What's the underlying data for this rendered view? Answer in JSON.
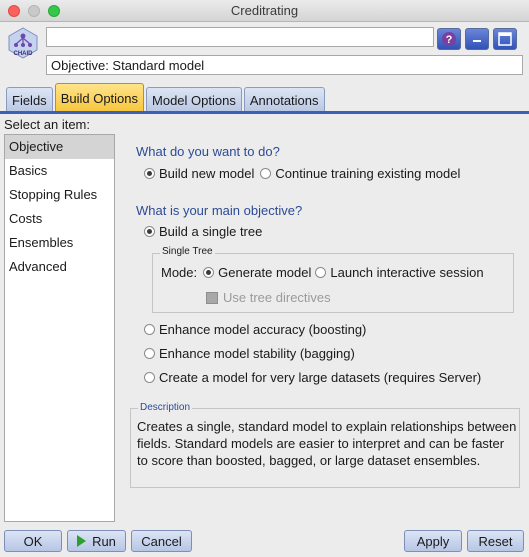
{
  "window": {
    "title": "Creditrating"
  },
  "header": {
    "node_name_value": "",
    "objective_line": "Objective: Standard model",
    "icon_name": "chaid-node-icon",
    "icon_label": "CHAID"
  },
  "tabs": [
    {
      "label": "Fields",
      "active": false
    },
    {
      "label": "Build Options",
      "active": true
    },
    {
      "label": "Model Options",
      "active": false
    },
    {
      "label": "Annotations",
      "active": false
    }
  ],
  "sidebar": {
    "label": "Select an item:",
    "items": [
      "Objective",
      "Basics",
      "Stopping Rules",
      "Costs",
      "Ensembles",
      "Advanced"
    ],
    "selected": "Objective"
  },
  "objective": {
    "question1": "What do you want to do?",
    "build_new": "Build new model",
    "continue_training": "Continue training existing model",
    "question2": "What is your main objective?",
    "single_tree": "Build a single tree",
    "single_tree_group": "Single Tree",
    "mode_label": "Mode:",
    "generate_model": "Generate model",
    "launch_session": "Launch interactive session",
    "use_tree_directives": "Use tree directives",
    "boosting": "Enhance model accuracy (boosting)",
    "bagging": "Enhance model stability (bagging)",
    "large_datasets": "Create a model for very large datasets (requires Server)",
    "description_title": "Description",
    "description_text": "Creates a single, standard model to explain relationships between fields.  Standard models are easier to interpret and can be faster to score than boosted, bagged, or large dataset ensembles."
  },
  "buttons": {
    "ok": "OK",
    "run": "Run",
    "cancel": "Cancel",
    "apply": "Apply",
    "reset": "Reset"
  },
  "colors": {
    "accent": "#3c5fb8",
    "active_tab": "#f7c53c",
    "section_label": "#2b4b95"
  }
}
